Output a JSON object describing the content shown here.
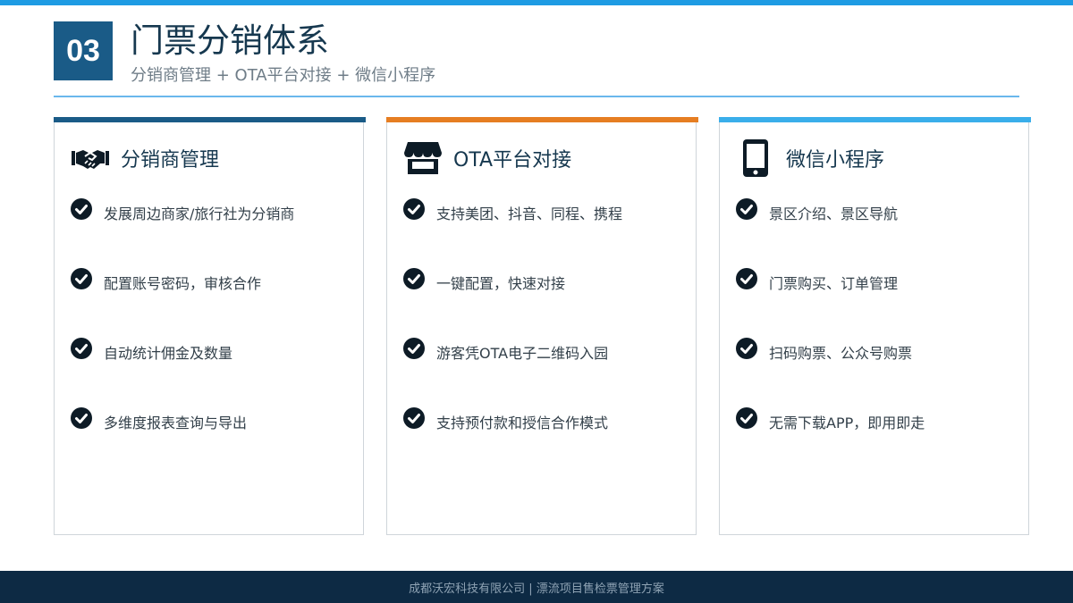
{
  "header": {
    "number": "03",
    "title": "门票分销体系",
    "subtitle": "分销商管理 + OTA平台对接 + 微信小程序"
  },
  "colors": {
    "top_bar": "#1e9be3",
    "number_box": "#1a5b87",
    "card_accents": [
      "#1a5b87",
      "#e67e22",
      "#3aaeea"
    ],
    "footer": "#0d2a44"
  },
  "cards": [
    {
      "title": "分销商管理",
      "icon": "handshake-icon",
      "items": [
        "发展周边商家/旅行社为分销商",
        "配置账号密码，审核合作",
        "自动统计佣金及数量",
        "多维度报表查询与导出"
      ]
    },
    {
      "title": "OTA平台对接",
      "icon": "store-icon",
      "items": [
        "支持美团、抖音、同程、携程",
        "一键配置，快速对接",
        "游客凭OTA电子二维码入园",
        "支持预付款和授信合作模式"
      ]
    },
    {
      "title": "微信小程序",
      "icon": "mobile-phone-icon",
      "items": [
        "景区介绍、景区导航",
        "门票购买、订单管理",
        "扫码购票、公众号购票",
        "无需下载APP，即用即走"
      ]
    }
  ],
  "footer": {
    "text": "成都沃宏科技有限公司 | 漂流项目售检票管理方案"
  }
}
